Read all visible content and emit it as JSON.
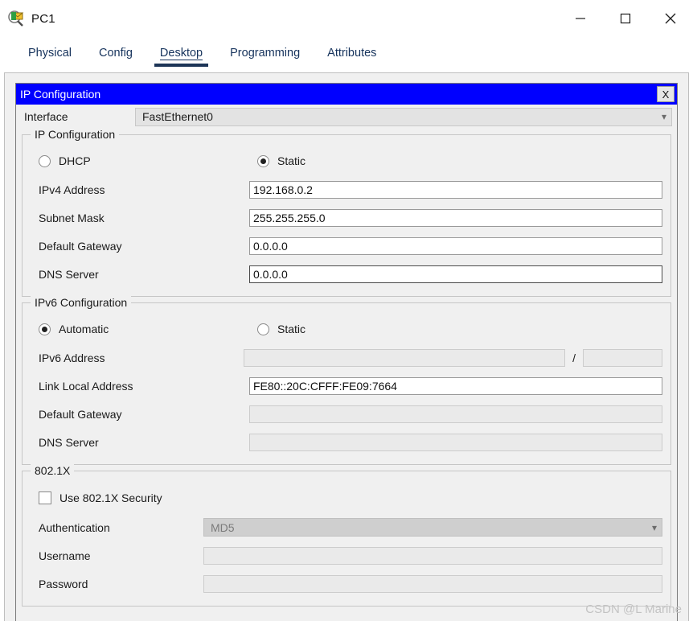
{
  "window": {
    "title": "PC1",
    "icon": "packet-tracer-icon",
    "controls": {
      "minimize": "minimize-icon",
      "maximize": "maximize-icon",
      "close": "close-icon"
    }
  },
  "tabs": [
    {
      "label": "Physical",
      "active": false
    },
    {
      "label": "Config",
      "active": false
    },
    {
      "label": "Desktop",
      "active": true
    },
    {
      "label": "Programming",
      "active": false
    },
    {
      "label": "Attributes",
      "active": false
    }
  ],
  "dialog": {
    "title": "IP Configuration",
    "close_label": "X",
    "interface": {
      "label": "Interface",
      "value": "FastEthernet0",
      "chevron": "chevron-down-icon"
    },
    "ipv4": {
      "group_title": "IP Configuration",
      "dhcp_label": "DHCP",
      "dhcp_selected": false,
      "static_label": "Static",
      "static_selected": true,
      "fields": [
        {
          "label": "IPv4 Address",
          "value": "192.168.0.2",
          "disabled": false,
          "focused": false
        },
        {
          "label": "Subnet Mask",
          "value": "255.255.255.0",
          "disabled": false,
          "focused": false
        },
        {
          "label": "Default Gateway",
          "value": "0.0.0.0",
          "disabled": false,
          "focused": false
        },
        {
          "label": "DNS Server",
          "value": "0.0.0.0",
          "disabled": false,
          "focused": true
        }
      ]
    },
    "ipv6": {
      "group_title": "IPv6 Configuration",
      "automatic_label": "Automatic",
      "automatic_selected": true,
      "static_label": "Static",
      "static_selected": false,
      "address": {
        "label": "IPv6 Address",
        "value": "",
        "separator": "/",
        "prefix_value": "",
        "disabled": true
      },
      "fields": [
        {
          "label": "Link Local Address",
          "value": "FE80::20C:CFFF:FE09:7664",
          "disabled": false
        },
        {
          "label": "Default Gateway",
          "value": "",
          "disabled": true
        },
        {
          "label": "DNS Server",
          "value": "",
          "disabled": true
        }
      ]
    },
    "dot1x": {
      "group_title": "802.1X",
      "use_security_label": "Use 802.1X Security",
      "use_security_checked": false,
      "authentication": {
        "label": "Authentication",
        "value": "MD5",
        "disabled": true,
        "chevron": "chevron-down-icon"
      },
      "username": {
        "label": "Username",
        "value": "",
        "disabled": true
      },
      "password": {
        "label": "Password",
        "value": "",
        "disabled": true
      }
    }
  },
  "watermark": "CSDN @L Marine"
}
